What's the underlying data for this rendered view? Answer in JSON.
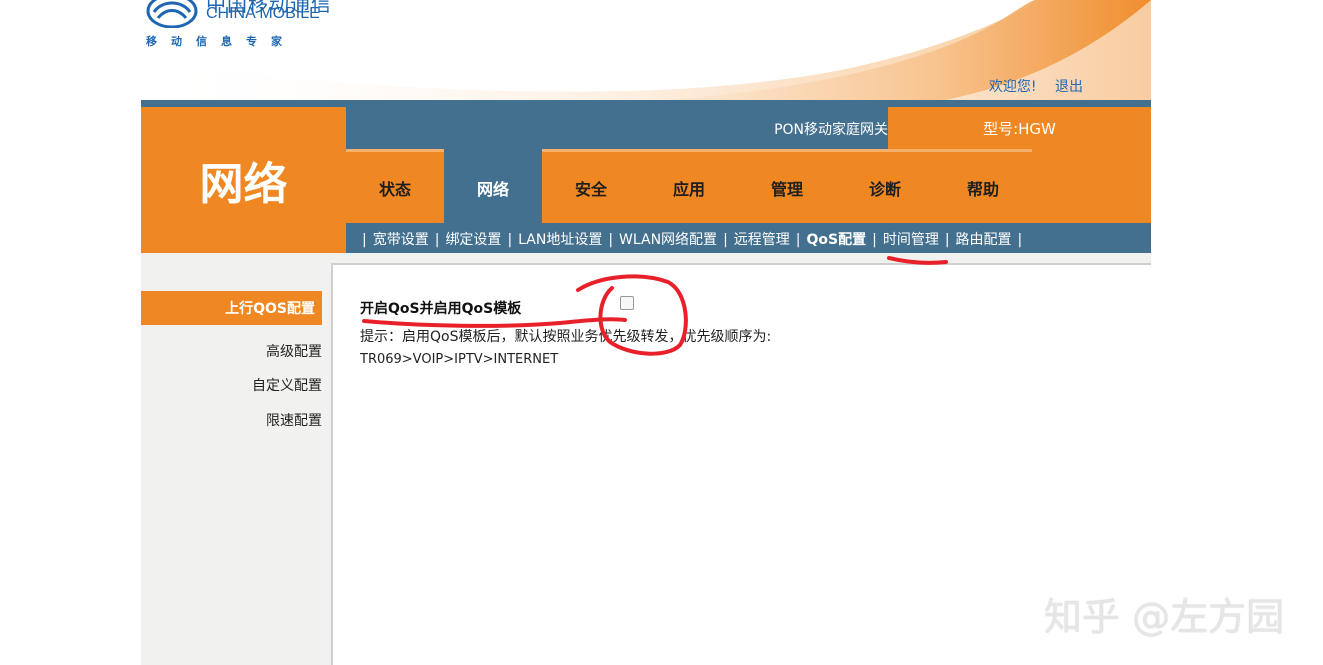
{
  "header": {
    "logo_cn": "中国移动通信",
    "logo_en": "CHINA MOBILE",
    "logo_slogan": "移动信息专家",
    "welcome": "欢迎您!",
    "logout": "退出"
  },
  "section_title": "网络",
  "topbar": {
    "product": "PON移动家庭网关",
    "model": "型号:HGW"
  },
  "main_nav": [
    "状态",
    "网络",
    "安全",
    "应用",
    "管理",
    "诊断",
    "帮助"
  ],
  "main_nav_active": "网络",
  "sub_nav": [
    "宽带设置",
    "绑定设置",
    "LAN地址设置",
    "WLAN网络配置",
    "远程管理",
    "QoS配置",
    "时间管理",
    "路由配置"
  ],
  "sub_nav_active": "QoS配置",
  "sidebar": {
    "active": "上行QOS配置",
    "items": [
      "高级配置",
      "自定义配置",
      "限速配置"
    ]
  },
  "content": {
    "qos_label": "开启QoS并启用QoS模板",
    "qos_checked": false,
    "hint": "提示：启用QoS模板后，默认按照业务优先级转发，优先级顺序为:",
    "order": "TR069>VOIP>IPTV>INTERNET"
  },
  "watermark": "知乎 @左方园",
  "colors": {
    "orange": "#ef8822",
    "steel_blue": "#44708f",
    "link_blue": "#1f66b8",
    "annotation_red": "#e8202a"
  }
}
